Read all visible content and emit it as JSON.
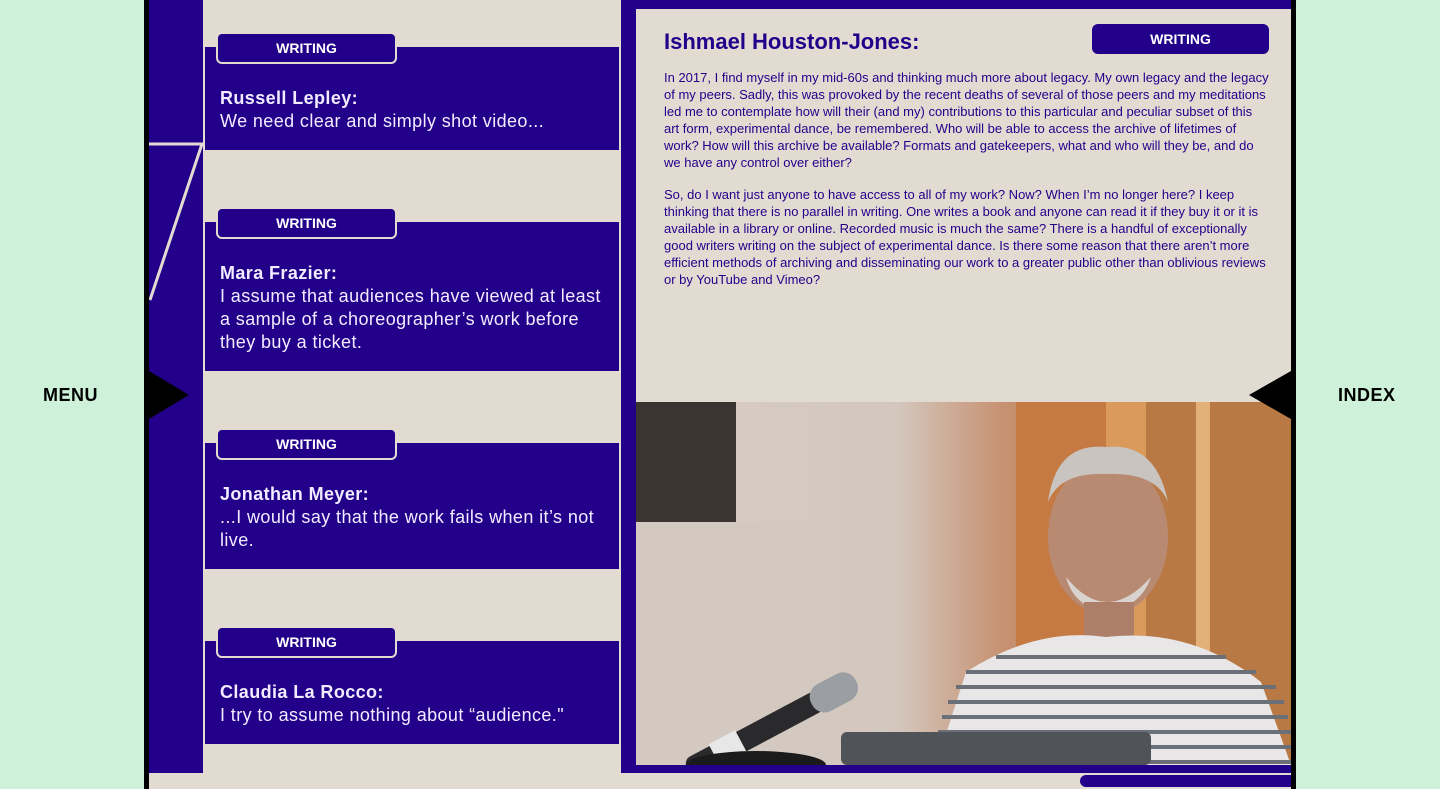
{
  "nav": {
    "menu_label": "MENU",
    "index_label": "INDEX"
  },
  "colors": {
    "accent": "#22008a",
    "page_bg": "#cdf2d9",
    "panel_bg": "#e2dbd2"
  },
  "cards": [
    {
      "tag": "WRITING",
      "name": "Russell Lepley:",
      "text": "We need clear and simply shot video..."
    },
    {
      "tag": "WRITING",
      "name": "Mara Frazier:",
      "text": "I assume that audiences have viewed at least a sample of a choreographer’s work before they buy a ticket."
    },
    {
      "tag": "WRITING",
      "name": "Jonathan Meyer:",
      "text": "...I would say that the work fails when it’s not live."
    },
    {
      "tag": "WRITING",
      "name": "Claudia La Rocco:",
      "text": "I try to assume nothing about “audience.\""
    }
  ],
  "article": {
    "title": "Ishmael Houston-Jones:",
    "tag": "WRITING",
    "paragraphs": [
      "In 2017, I find myself in my mid-60s and thinking much more about legacy. My own legacy and the legacy of my peers. Sadly, this was provoked by the recent deaths of several of those peers and my meditations led me to contemplate how will their (and my) contributions to this particular and peculiar subset of this art form, experimental dance, be remembered. Who will be able to access the archive of lifetimes of work? How will this archive be available? Formats and gatekeepers, what and who will they be, and do we have any control over either?",
      "So, do I want just anyone to have access to all of my work? Now? When I’m no longer here? I keep thinking that there is no parallel in writing. One writes a book and anyone can read it if they buy it or it is available in a library or online. Recorded music is much the same? There is a handful of exceptionally good writers writing on the subject of experimental dance. Is there some reason that there aren’t more efficient methods of archiving and disseminating our work to a greater public other than oblivious reviews or by YouTube and Vimeo?"
    ]
  }
}
